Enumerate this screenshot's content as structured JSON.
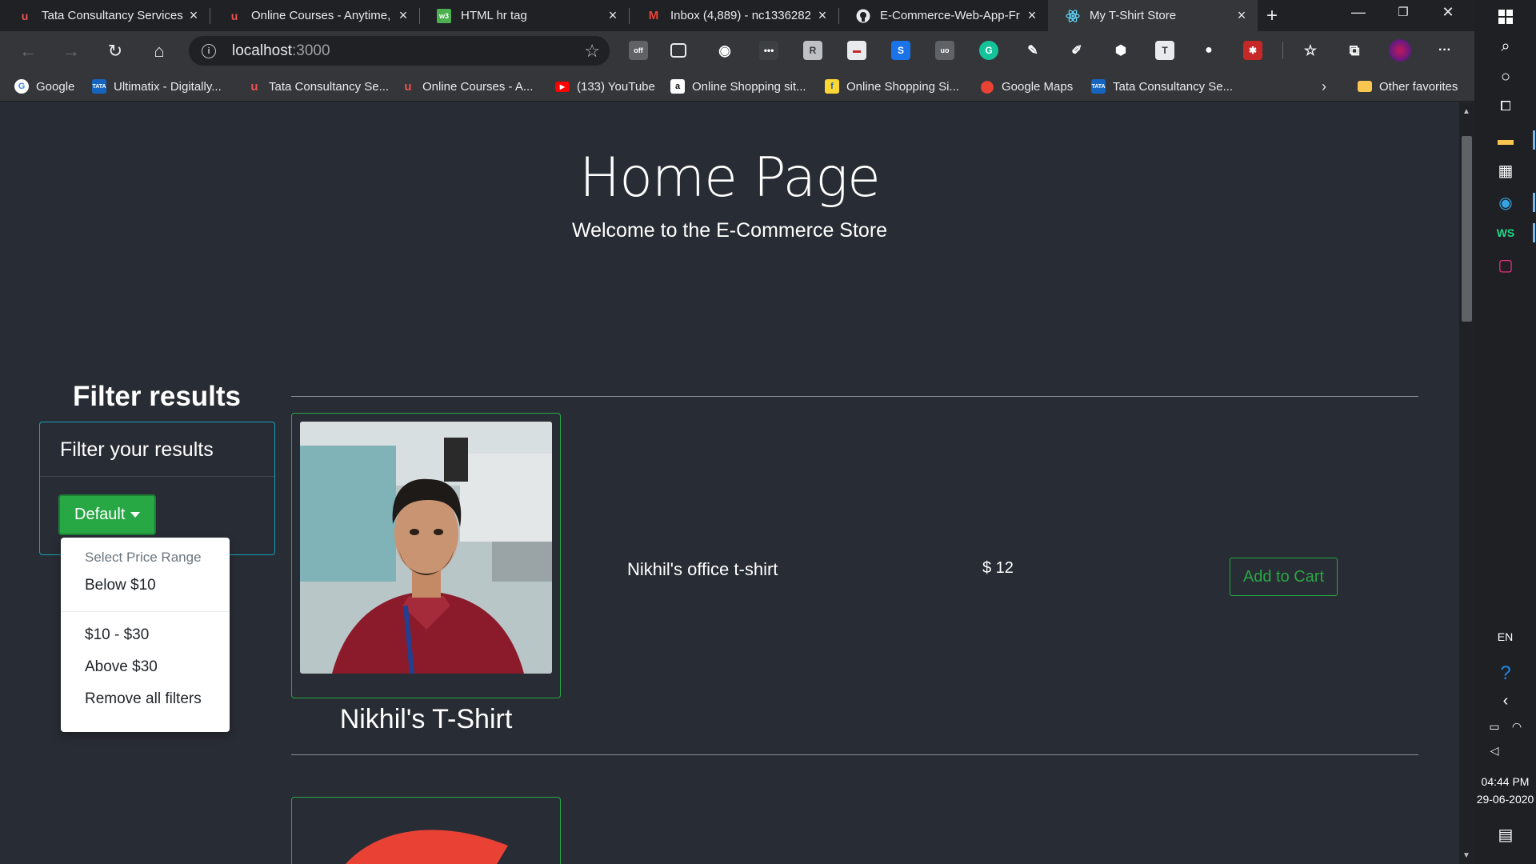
{
  "browser": {
    "tabs": [
      {
        "title": "Tata Consultancy Services E",
        "icon": "udemy-icon",
        "active": false
      },
      {
        "title": "Online Courses - Anytime,",
        "icon": "udemy-icon",
        "active": false
      },
      {
        "title": "HTML hr tag",
        "icon": "w3schools-icon",
        "active": false
      },
      {
        "title": "Inbox (4,889) - nc1336282",
        "icon": "gmail-icon",
        "active": false
      },
      {
        "title": "E-Commerce-Web-App-Fr",
        "icon": "github-icon",
        "active": false
      },
      {
        "title": "My T-Shirt Store",
        "icon": "react-icon",
        "active": true
      }
    ],
    "address": {
      "host": "localhost",
      "port": ":3000"
    },
    "bookmarks": [
      {
        "label": "Google",
        "icon": "google-icon"
      },
      {
        "label": "Ultimatix - Digitally...",
        "icon": "tata-icon"
      },
      {
        "label": "Tata Consultancy Se...",
        "icon": "udemy-icon"
      },
      {
        "label": "Online Courses - A...",
        "icon": "udemy-icon"
      },
      {
        "label": "(133) YouTube",
        "icon": "youtube-icon"
      },
      {
        "label": "Online Shopping sit...",
        "icon": "amazon-icon"
      },
      {
        "label": "Online Shopping Si...",
        "icon": "flipkart-icon"
      },
      {
        "label": "Google Maps",
        "icon": "maps-icon"
      },
      {
        "label": "Tata Consultancy Se...",
        "icon": "tata-icon"
      }
    ],
    "other_favorites": "Other favorites"
  },
  "page": {
    "title": "Home Page",
    "subtitle": "Welcome to the E-Commerce Store",
    "filter": {
      "heading": "Filter results",
      "card_title": "Filter your results",
      "dropdown_label": "Default",
      "menu_header": "Select Price Range",
      "options": [
        "Below $10",
        "$10 - $30",
        "Above $30",
        "Remove all filters"
      ]
    },
    "product": {
      "name": "Nikhil's T-Shirt",
      "description": "Nikhil's office t-shirt",
      "price": "$ 12",
      "add_to_cart": "Add to Cart"
    }
  },
  "taskbar": {
    "language": "EN",
    "time": "04:44 PM",
    "date": "29-06-2020"
  },
  "colors": {
    "page_bg": "#282c34",
    "accent_green": "#28a745",
    "card_border": "#17a2b8"
  }
}
